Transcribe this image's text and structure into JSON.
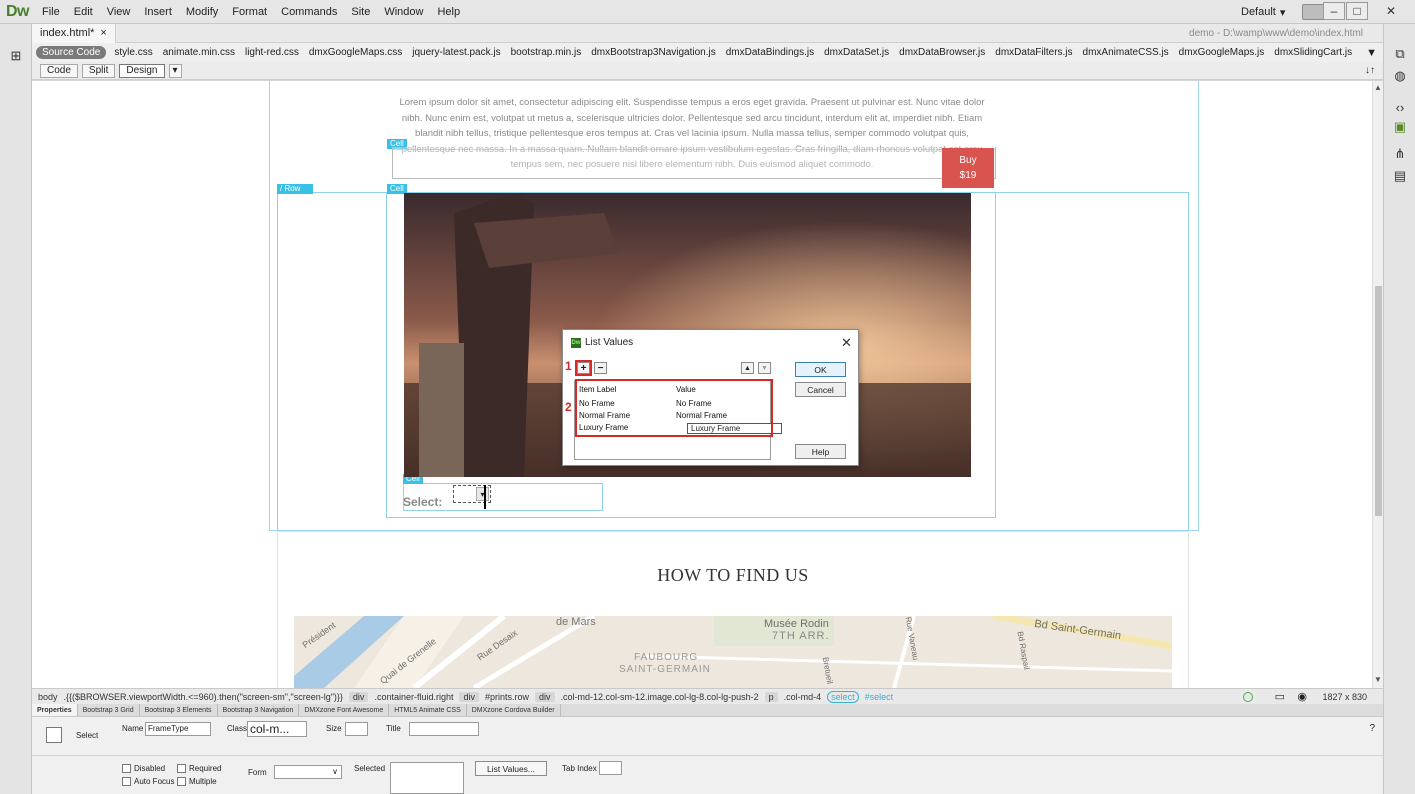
{
  "app": {
    "logo": "Dw",
    "menu": [
      "File",
      "Edit",
      "View",
      "Insert",
      "Modify",
      "Format",
      "Commands",
      "Site",
      "Window",
      "Help"
    ],
    "layout": "Default",
    "document_tab": "index.html*",
    "document_path": "demo - D:\\wamp\\www\\demo\\index.html"
  },
  "related_files": {
    "source_code": "Source Code",
    "files": [
      "style.css",
      "animate.min.css",
      "light-red.css",
      "dmxGoogleMaps.css",
      "jquery-latest.pack.js",
      "bootstrap.min.js",
      "dmxBootstrap3Navigation.js",
      "dmxDataBindings.js",
      "dmxDataSet.js",
      "dmxDataBrowser.js",
      "dmxDataFilters.js",
      "dmxAnimateCSS.js",
      "dmxGoogleMaps.js",
      "dmxSlidingCart.js"
    ]
  },
  "views": {
    "code": "Code",
    "split": "Split",
    "design": "Design"
  },
  "canvas": {
    "lorem": "Lorem ipsum dolor sit amet, consectetur adipiscing elit. Suspendisse tempus a eros eget gravida. Praesent ut pulvinar est. Nunc vitae dolor nibh. Nunc enim est, volutpat ut metus a, scelerisque ultricies dolor. Pellentesque sed arcu tincidunt, interdum elit at, imperdiet nibh. Etiam blandit nibh tellus, tristique pellentesque eros tempus at. Cras vel lacinia ipsum. Nulla massa tellus, semper commodo volutpat quis, pellentesque nec massa. In a massa quam. Nullam blandit ornare ipsum vestibulum egestas. Cras fringilla, diam rhoncus volutpat est arcu tempus sem, nec posuere nisl libero elementum nibh. Duis euismod aliquet commodo.",
    "buy_label": "Buy",
    "buy_price": "$19",
    "cell_tag": "Cell",
    "row_tag": "/ Row",
    "select_label": "Select:",
    "heading": "HOW TO FIND US",
    "map_labels": [
      "de Mars",
      "Musée Rodin",
      "7TH ARR.",
      "FAUBOURG",
      "SAINT-GERMAIN",
      "Bd Saint-Germain",
      "Rue Desaix",
      "Quai de Grenelle",
      "Rue Vaneau",
      "Bd Raspail",
      "Bretueil",
      "Président"
    ]
  },
  "dialog": {
    "title": "List Values",
    "add": "+",
    "remove": "−",
    "up": "▲",
    "down": "▼",
    "columns": {
      "label": "Item Label",
      "value": "Value"
    },
    "rows": [
      {
        "label": "No Frame",
        "value": "No Frame"
      },
      {
        "label": "Normal Frame",
        "value": "Normal Frame"
      },
      {
        "label": "Luxury Frame",
        "value": "Luxury Frame"
      }
    ],
    "ok": "OK",
    "cancel": "Cancel",
    "help": "Help",
    "annot_1": "1",
    "annot_2": "2"
  },
  "tag_selector": {
    "items": [
      "body",
      ".{{($BROWSER.viewportWidth.<=960).then(\"screen-sm\",\"screen-lg\")}}",
      "div",
      ".container-fluid.right",
      "div",
      "#prints.row",
      "div",
      ".col-md-12.col-sm-12.image.col-lg-8.col-lg-push-2",
      "p",
      ".col-md-4"
    ],
    "selected_tag": "select",
    "selected_id": "#select",
    "viewport": "1827 x 830"
  },
  "properties": {
    "tabs": [
      "Properties",
      "Bootstrap 3 Grid",
      "Bootstrap 3 Elements",
      "Bootstrap 3 Navigation",
      "DMXzone Font Awesome",
      "HTML5 Animate CSS",
      "DMXzone Cordova Builder"
    ],
    "element_type": "Select",
    "name_label": "Name",
    "name_value": "FrameType",
    "class_label": "Class",
    "class_value": "col-m...",
    "size_label": "Size",
    "title_label": "Title",
    "disabled_label": "Disabled",
    "required_label": "Required",
    "autofocus_label": "Auto Focus",
    "multiple_label": "Multiple",
    "form_label": "Form",
    "selected_label": "Selected",
    "list_values_btn": "List Values...",
    "tab_index_label": "Tab Index"
  }
}
